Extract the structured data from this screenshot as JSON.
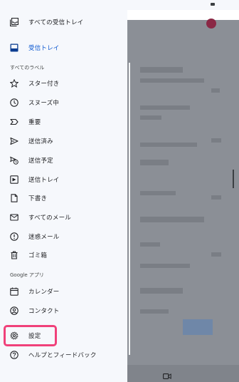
{
  "drawer": {
    "items": [
      {
        "name": "all-inboxes",
        "label": "すべての受信トレイ",
        "icon": "all-inboxes-icon"
      },
      {
        "name": "inbox",
        "label": "受信トレイ",
        "icon": "inbox-icon",
        "active": true
      },
      {
        "name": "starred",
        "label": "スター付き",
        "icon": "star-icon"
      },
      {
        "name": "snoozed",
        "label": "スヌーズ中",
        "icon": "clock-icon"
      },
      {
        "name": "important",
        "label": "重要",
        "icon": "important-icon"
      },
      {
        "name": "sent",
        "label": "送信済み",
        "icon": "send-icon"
      },
      {
        "name": "scheduled",
        "label": "送信予定",
        "icon": "scheduled-send-icon"
      },
      {
        "name": "outbox",
        "label": "送信トレイ",
        "icon": "outbox-icon"
      },
      {
        "name": "drafts",
        "label": "下書き",
        "icon": "draft-icon"
      },
      {
        "name": "all-mail",
        "label": "すべてのメール",
        "icon": "all-mail-icon"
      },
      {
        "name": "spam",
        "label": "迷惑メール",
        "icon": "spam-icon"
      },
      {
        "name": "trash",
        "label": "ゴミ箱",
        "icon": "trash-icon"
      },
      {
        "name": "calendar",
        "label": "カレンダー",
        "icon": "calendar-icon"
      },
      {
        "name": "contacts",
        "label": "コンタクト",
        "icon": "contacts-icon"
      },
      {
        "name": "settings",
        "label": "設定",
        "icon": "gear-icon"
      },
      {
        "name": "help-feedback",
        "label": "ヘルプとフィードバック",
        "icon": "help-icon"
      }
    ],
    "sections": {
      "all_labels": "すべてのラベル",
      "google_apps": "Google アプリ"
    }
  },
  "colors": {
    "accent": "#0b57d0",
    "highlight": "#f0417a",
    "scrim": "#8b8f96"
  }
}
